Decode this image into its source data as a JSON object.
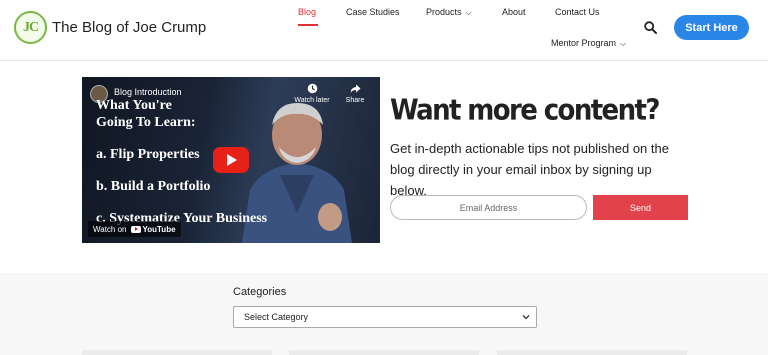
{
  "header": {
    "logo_initials": "JC",
    "site_title": "The Blog of Joe Crump",
    "nav": {
      "blog": "Blog",
      "case_studies": "Case Studies",
      "products": "Products",
      "about": "About",
      "contact": "Contact Us",
      "mentor": "Mentor Program"
    },
    "start_button": "Start Here",
    "search_icon": "search-icon"
  },
  "video": {
    "title": "Blog Introduction",
    "watch_later": "Watch later",
    "share": "Share",
    "slide_heading_line1": "What You're",
    "slide_heading_line2": "Going To Learn:",
    "slide_items": [
      "a. Flip Properties",
      "b. Build a Portfolio",
      "c. Systematize Your Business"
    ],
    "watch_on": "Watch on",
    "youtube": "YouTube"
  },
  "signup": {
    "title": "Want more content?",
    "description": "Get in-depth actionable tips not published on the blog directly in your email inbox by signing up below.",
    "email_placeholder": "Email Address",
    "send_label": "Send",
    "accent_color": "#e2424b"
  },
  "categories": {
    "label": "Categories",
    "selected": "Select Category"
  },
  "colors": {
    "primary_button": "#2a86e6",
    "active_nav": "#e03131",
    "logo_green": "#79b845"
  }
}
